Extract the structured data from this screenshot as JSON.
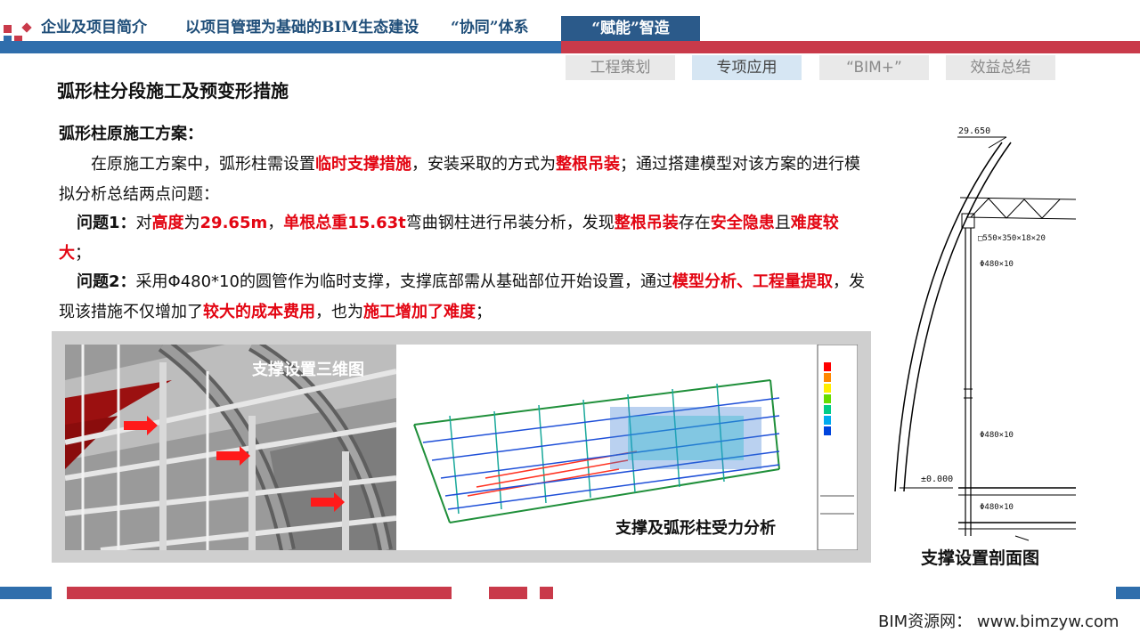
{
  "header": {
    "nav": [
      "企业及项目简介",
      "以项目管理为基础的BIM生态建设",
      "“协同”体系"
    ],
    "active": "“赋能”智造"
  },
  "subtabs": [
    "工程策划",
    "专项应用",
    "“BIM+”",
    "效益总结"
  ],
  "title": "弧形柱分段施工及预变形措施",
  "content": {
    "heading": "弧形柱原施工方案：",
    "para1_a": "在原施工方案中，弧形柱需设置",
    "para1_r1": "临时支撑措施",
    "para1_b": "，安装采取的方式为",
    "para1_r2": "整根吊装",
    "para1_c": "；通过搭建模型对该方案的进行模拟分析总结两点问题：",
    "q1_label": "问题1：",
    "q1_a": "对",
    "q1_r1": "高度",
    "q1_b": "为",
    "q1_r2": "29.65m",
    "q1_c": "，",
    "q1_r3": "单根总重15.63t",
    "q1_d": "弯曲钢柱进行吊装分析，发现",
    "q1_r4": "整根吊装",
    "q1_e": "存在",
    "q1_r5": "安全隐患",
    "q1_f": "且",
    "q1_r6": "难度较大",
    "q1_g": "；",
    "q2_label": "问题2：",
    "q2_a": "采用Φ480*10的圆管作为临时支撑，支撑底部需从基础部位开始设置，通过",
    "q2_r1": "模型分析、工程量提取",
    "q2_b": "，发现该措施不仅增加了",
    "q2_r2": "较大的成本费用",
    "q2_c": "，也为",
    "q2_r3": "施工增加了难度",
    "q2_d": "；"
  },
  "captions": {
    "model3d": "支撑设置三维图",
    "analysis": "支撑及弧形柱受力分析",
    "section": "支撑设置剖面图"
  },
  "drawing": {
    "top_elev": "29.650",
    "beam_label": "□550×350×18×20",
    "pipe1": "Φ480×10",
    "pipe2": "Φ480×10",
    "pipe3": "Φ480×10",
    "zero_elev": "±0.000"
  },
  "footer": {
    "credit": "BIM资源网：  www.bimzyw.com"
  },
  "colors": {
    "accent_red": "#e30613",
    "nav_blue": "#1f4e79",
    "bar_blue": "#2f6eac",
    "bar_red": "#c93a4a"
  }
}
